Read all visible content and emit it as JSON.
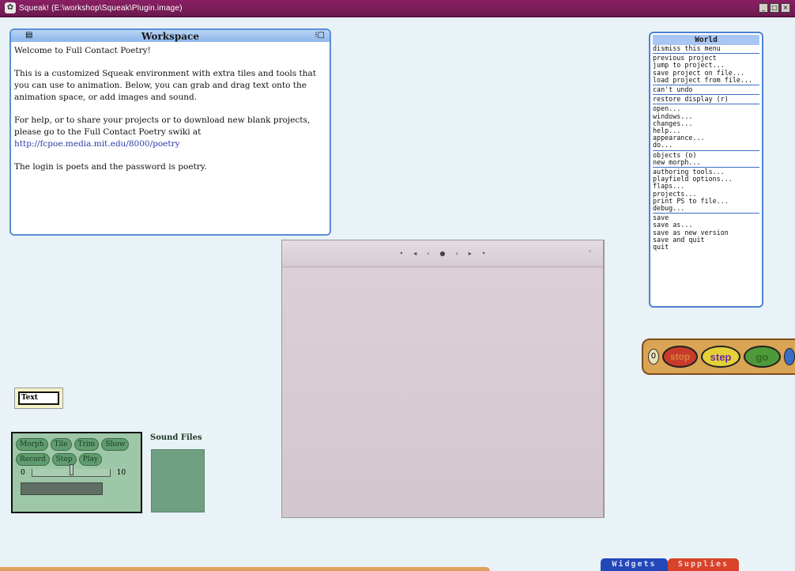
{
  "window": {
    "title": "Squeak! (E:\\workshop\\Squeak\\Plugin.image)",
    "controls": [
      "_",
      "□",
      "×"
    ]
  },
  "workspace": {
    "title": "Workspace",
    "paragraphs": [
      "Welcome to Full Contact Poetry!",
      "This is a customized Squeak environment with extra tiles and tools that you can use to animation.  Below, you can grab and drag text onto the animation space, or add images and sound.",
      "For help, or to share your projects or to download new blank projects, please go to the Full Contact Poetry swiki at",
      "The login is poets and the password is poetry."
    ],
    "link": "http://fcpoe.media.mit.edu/8000/poetry"
  },
  "world_menu": {
    "title": "World",
    "groups": [
      [
        "dismiss this menu"
      ],
      [
        "previous project",
        "jump to project...",
        "save project on file...",
        "load project from file..."
      ],
      [
        "can't undo"
      ],
      [
        "restore display (r)"
      ],
      [
        "open...",
        "windows...",
        "changes...",
        "help...",
        "appearance...",
        "do..."
      ],
      [
        "objects (o)",
        "new morph..."
      ],
      [
        "authoring tools...",
        "playfield options...",
        "flaps...",
        "projects...",
        "print PS to file...",
        "debug..."
      ],
      [
        "save",
        "save as...",
        "save as new version",
        "save and quit",
        "quit"
      ]
    ]
  },
  "control_bar": {
    "left_label": "0",
    "stop": "stop",
    "step": "step",
    "go": "go"
  },
  "canvas_toolbar": [
    "•",
    "◂",
    "‹",
    "●",
    "›",
    "▸",
    "•"
  ],
  "canvas_settings_icon": "◦",
  "text_tile": {
    "label": "Text"
  },
  "flap": {
    "row1": [
      "Morph",
      "Tile",
      "Trim",
      "Show"
    ],
    "row2": [
      "Record",
      "Stop",
      "Play"
    ],
    "slider_min": "0",
    "slider_max": "10",
    "slider_level_fraction": 0.5
  },
  "sound_files": {
    "label": "Sound Files"
  },
  "bottom_tabs": {
    "widgets": "Widgets",
    "supplies": "Supplies"
  }
}
